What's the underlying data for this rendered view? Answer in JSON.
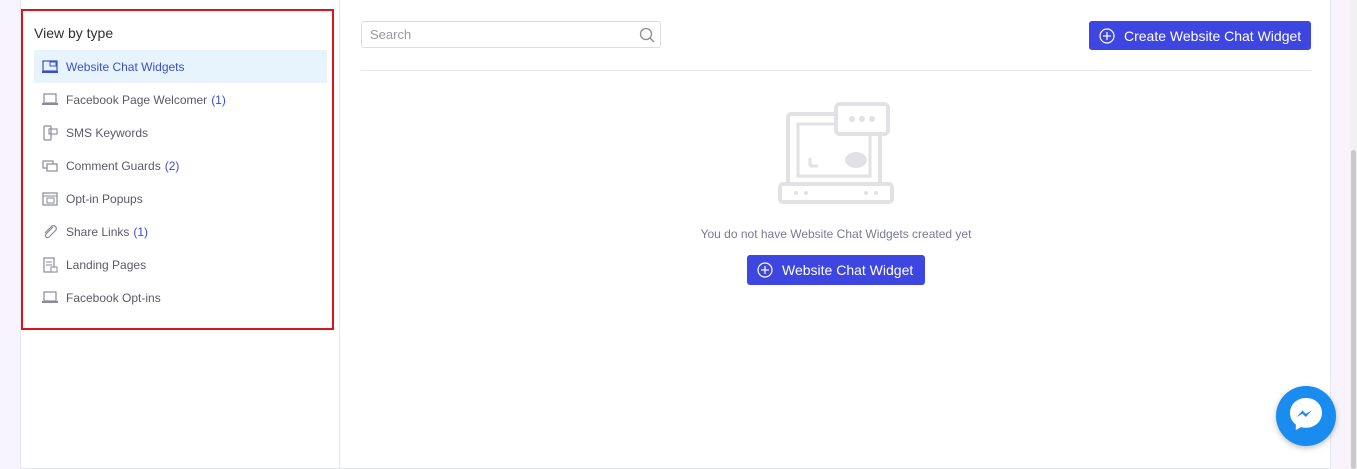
{
  "sidebar": {
    "title": "View by type",
    "items": [
      {
        "label": "Website Chat Widgets",
        "count": "",
        "icon": "chat-widget-icon",
        "active": true
      },
      {
        "label": "Facebook Page Welcomer",
        "count": "(1)",
        "icon": "laptop-icon",
        "active": false
      },
      {
        "label": "SMS Keywords",
        "count": "",
        "icon": "sms-icon",
        "active": false
      },
      {
        "label": "Comment Guards",
        "count": "(2)",
        "icon": "comment-icon",
        "active": false
      },
      {
        "label": "Opt-in Popups",
        "count": "",
        "icon": "popup-icon",
        "active": false
      },
      {
        "label": "Share Links",
        "count": "(1)",
        "icon": "paperclip-icon",
        "active": false
      },
      {
        "label": "Landing Pages",
        "count": "",
        "icon": "page-icon",
        "active": false
      },
      {
        "label": "Facebook Opt-ins",
        "count": "",
        "icon": "laptop-icon",
        "active": false
      }
    ]
  },
  "search": {
    "placeholder": "Search",
    "value": ""
  },
  "toolbar": {
    "create_label": "Create Website Chat Widget"
  },
  "empty_state": {
    "message": "You do not have Website Chat Widgets created yet",
    "button_label": "Website Chat Widget"
  },
  "colors": {
    "accent": "#3d46e0",
    "active_bg": "#e8f4fd",
    "highlight_border": "#d9141b",
    "messenger": "#1a8cf0"
  }
}
